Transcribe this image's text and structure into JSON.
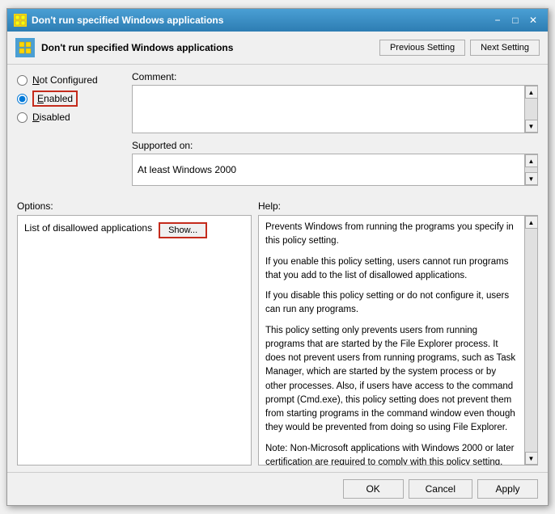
{
  "window": {
    "title": "Don't run specified Windows applications",
    "header_title": "Don't run specified Windows applications"
  },
  "header": {
    "prev_button": "Previous Setting",
    "next_button": "Next Setting"
  },
  "radio": {
    "not_configured": "Not Configured",
    "enabled": "Enabled",
    "disabled": "Disabled",
    "selected": "enabled"
  },
  "comment": {
    "label": "Comment:"
  },
  "supported": {
    "label": "Supported on:",
    "value": "At least Windows 2000"
  },
  "options": {
    "title": "Options:",
    "list_label": "List of disallowed applications",
    "show_button": "Show..."
  },
  "help": {
    "title": "Help:",
    "paragraphs": [
      "Prevents Windows from running the programs you specify in this policy setting.",
      "If you enable this policy setting, users cannot run programs that you add to the list of disallowed applications.",
      "If you disable this policy setting or do not configure it, users can run any programs.",
      "This policy setting only prevents users from running programs that are started by the File Explorer process. It does not prevent users from running programs, such as Task Manager, which are started by the system process or by other processes.  Also, if users have access to the command prompt (Cmd.exe), this policy setting does not prevent them from starting programs in the command window even though they would be prevented from doing so using File Explorer.",
      "Note: Non-Microsoft applications with Windows 2000 or later certification are required to comply with this policy setting.  Note: To create a list of allowed applications, click Show.  In the"
    ]
  },
  "buttons": {
    "ok": "OK",
    "cancel": "Cancel",
    "apply": "Apply"
  }
}
